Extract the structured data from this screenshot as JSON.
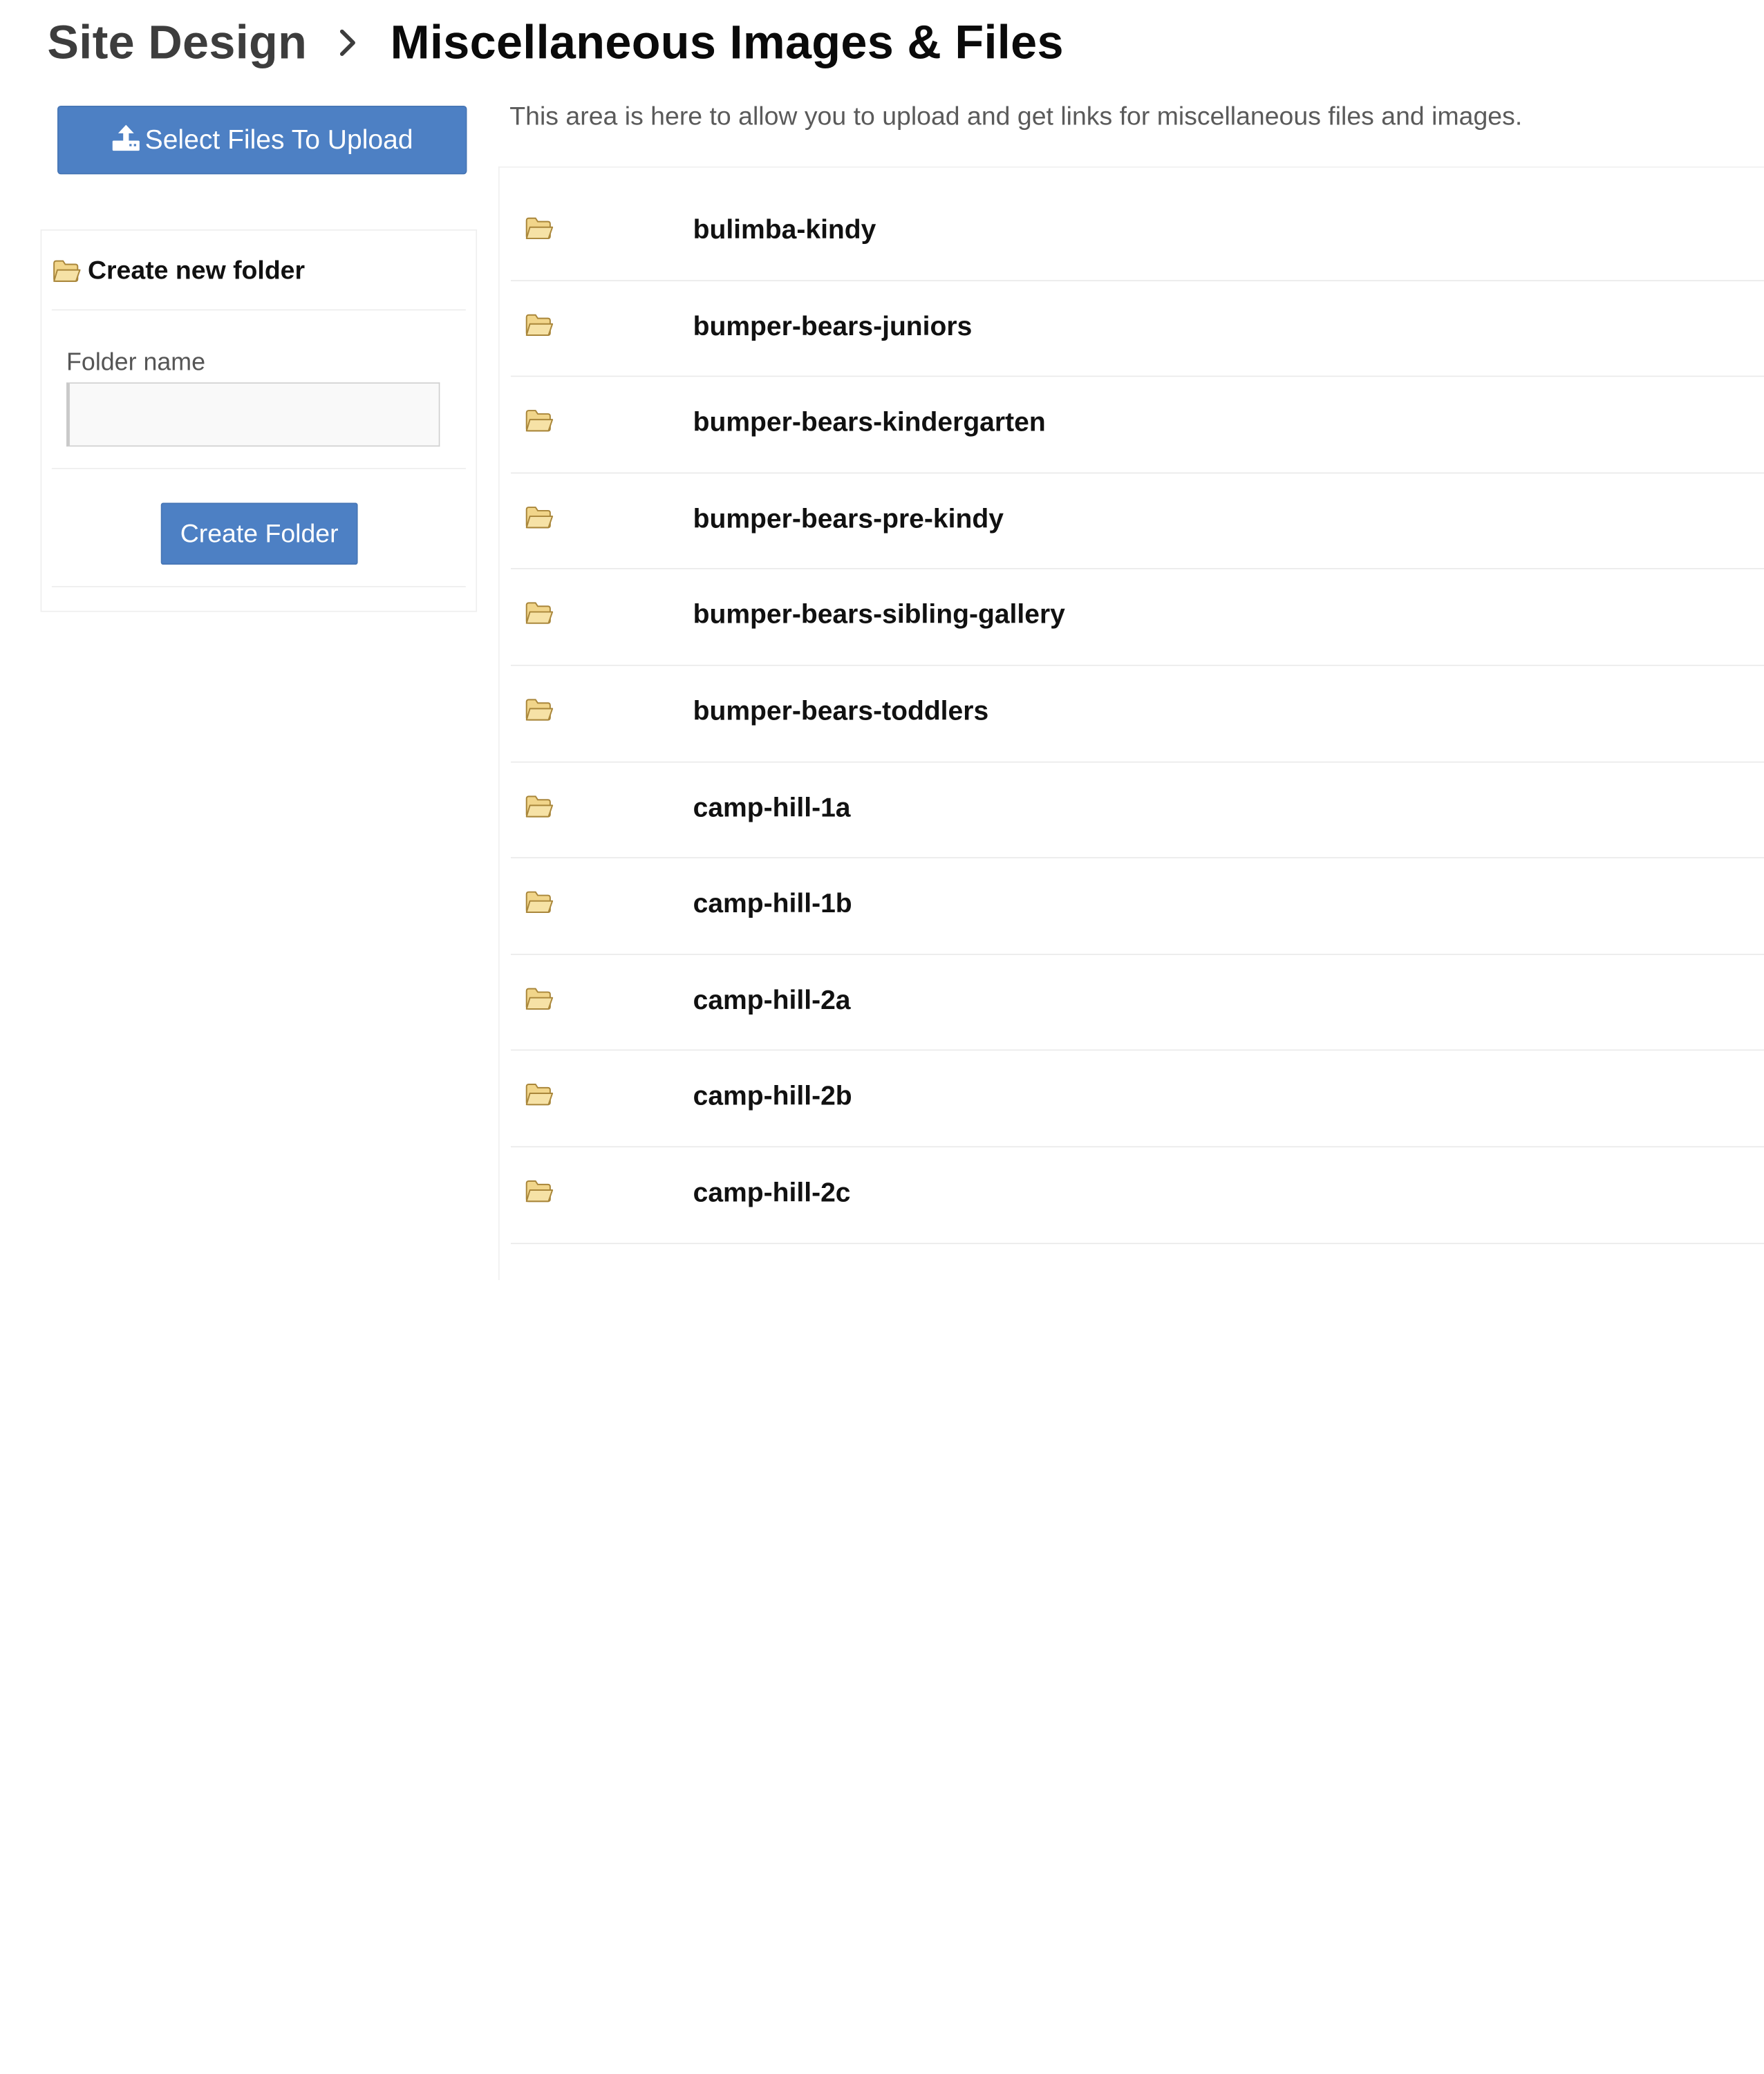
{
  "breadcrumb": {
    "parent": "Site Design",
    "separator_icon": "chevron-right-icon",
    "current": "Miscellaneous Images & Files"
  },
  "upload": {
    "label": "Select Files To Upload",
    "icon": "upload-icon"
  },
  "description": "This area is here to allow you to upload and get links for miscellaneous files and images.",
  "create_folder": {
    "title": "Create new folder",
    "icon": "folder-open-icon",
    "field_label": "Folder name",
    "field_value": "",
    "button_label": "Create Folder"
  },
  "folders": [
    {
      "name": "bulimba-kindy"
    },
    {
      "name": "bumper-bears-juniors"
    },
    {
      "name": "bumper-bears-kindergarten"
    },
    {
      "name": "bumper-bears-pre-kindy"
    },
    {
      "name": "bumper-bears-sibling-gallery"
    },
    {
      "name": "bumper-bears-toddlers"
    },
    {
      "name": "camp-hill-1a"
    },
    {
      "name": "camp-hill-1b"
    },
    {
      "name": "camp-hill-2a"
    },
    {
      "name": "camp-hill-2b"
    },
    {
      "name": "camp-hill-2c"
    }
  ],
  "colors": {
    "primary_button": "#4d80c4",
    "folder_icon": "#e8c66a"
  }
}
